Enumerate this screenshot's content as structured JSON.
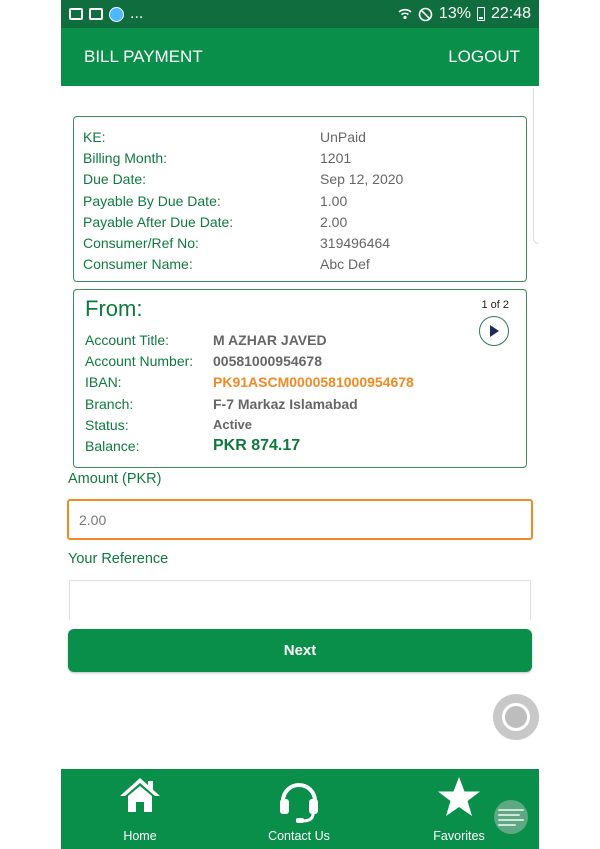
{
  "status_bar": {
    "left_text": "...",
    "battery": "13%",
    "time": "22:48"
  },
  "header": {
    "title": "BILL PAYMENT",
    "logout_label": "LOGOUT"
  },
  "bill": {
    "rows": [
      {
        "label": "KE:",
        "value": "UnPaid"
      },
      {
        "label": "Billing Month:",
        "value": "1201"
      },
      {
        "label": "Due Date:",
        "value": "Sep 12, 2020"
      },
      {
        "label": "Payable By Due Date:",
        "value": "1.00"
      },
      {
        "label": "Payable After Due Date:",
        "value": "2.00"
      },
      {
        "label": "Consumer/Ref No:",
        "value": "319496464"
      },
      {
        "label": "Consumer Name:",
        "value": "Abc Def"
      }
    ]
  },
  "from": {
    "title": "From:",
    "pager": "1 of 2",
    "rows": [
      {
        "label": "Account Title:",
        "value": "M AZHAR JAVED"
      },
      {
        "label": "Account Number:",
        "value": "00581000954678"
      },
      {
        "label": "IBAN:",
        "value": "PK91ASCM0000581000954678"
      },
      {
        "label": "Branch:",
        "value": "F-7 Markaz Islamabad"
      },
      {
        "label": "Status:",
        "value": "Active"
      },
      {
        "label": "Balance:",
        "value": "PKR 874.17"
      }
    ]
  },
  "form": {
    "amount_label": "Amount (PKR)",
    "amount_value": "2.00",
    "reference_label": "Your Reference",
    "reference_value": "",
    "next_label": "Next"
  },
  "nav": {
    "items": [
      {
        "label": "Home",
        "icon": "home-icon"
      },
      {
        "label": "Contact Us",
        "icon": "headset-icon"
      },
      {
        "label": "Favorites",
        "icon": "star-icon"
      }
    ]
  },
  "colors": {
    "primary": "#0a8f4a",
    "status_bar": "#0f6d3e",
    "accent_orange": "#f08a24",
    "label_green": "#0f7a3f"
  }
}
